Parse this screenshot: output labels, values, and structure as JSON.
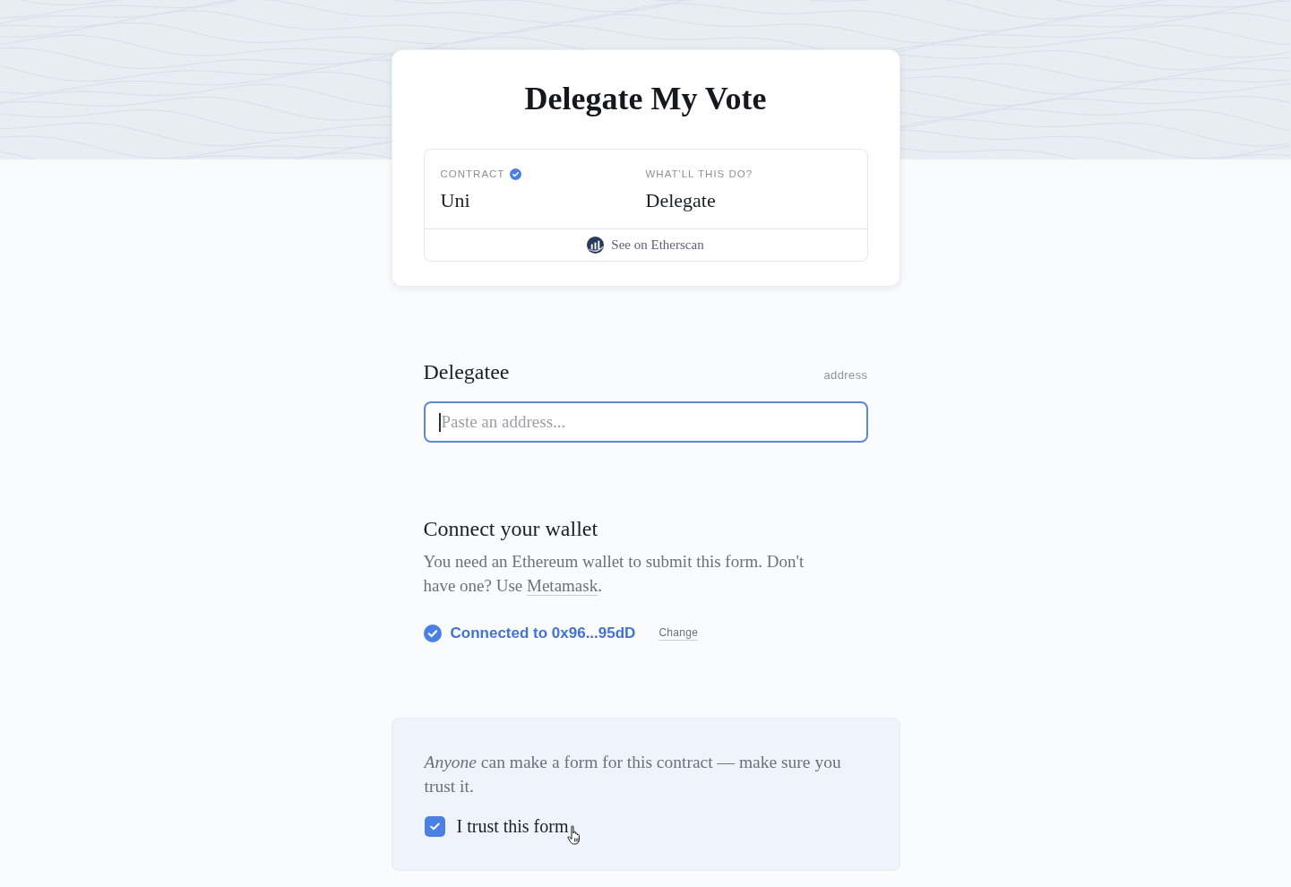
{
  "header": {
    "title": "Delegate My Vote"
  },
  "contract_info": {
    "fields": [
      {
        "label": "CONTRACT",
        "value": "Uni",
        "verified": true
      },
      {
        "label": "WHAT'LL THIS DO?",
        "value": "Delegate",
        "verified": false
      }
    ],
    "link": "See on Etherscan"
  },
  "delegatee": {
    "label": "Delegatee",
    "type_hint": "address",
    "placeholder": "Paste an address...",
    "focused": true
  },
  "wallet": {
    "heading": "Connect your wallet",
    "description": "You need an Ethereum wallet to submit this form. Don't have one? Use ",
    "link": "Metamask",
    "description_end": ".",
    "connected": true,
    "status": "Connected to 0x96...95dD",
    "change": "Change"
  },
  "trust": {
    "notice": "*Anyone* can make a form for this contract — make sure you trust it.",
    "checkbox": {
      "label": "I trust this form",
      "checked": true
    }
  }
}
